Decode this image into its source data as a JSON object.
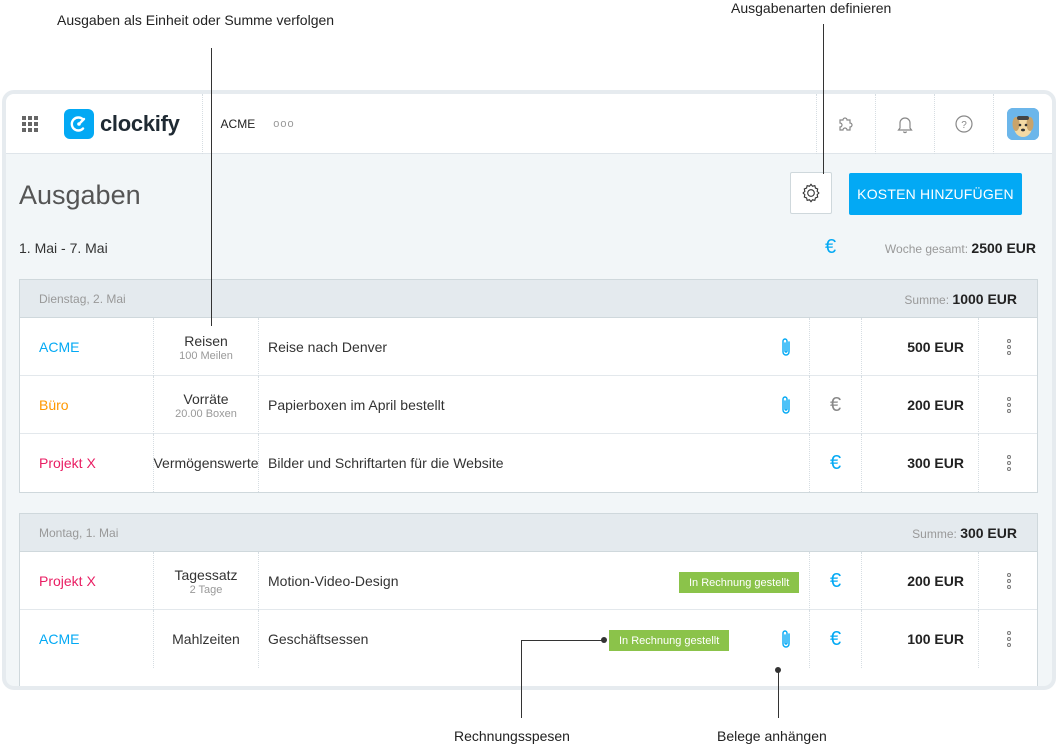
{
  "annotations": {
    "track_units": "Ausgaben als Einheit oder Summe verfolgen",
    "define_types": "Ausgabenarten definieren",
    "invoice_expenses": "Rechnungsspesen",
    "attach_receipts": "Belege anhängen"
  },
  "topbar": {
    "app_name": "clockify",
    "workspace": "ACME",
    "more": "ooo",
    "icons": [
      "apps-grid-icon",
      "puzzle-icon",
      "bell-icon",
      "help-icon",
      "avatar"
    ]
  },
  "page": {
    "title": "Ausgaben",
    "add_button": "KOSTEN HINZUFÜGEN",
    "range": "1. Mai - 7. Mai",
    "currency_symbol": "€",
    "week_total_label": "Woche gesamt: ",
    "week_total_value": "2500 EUR"
  },
  "colors": {
    "brand": "#03a9f4",
    "acme": "#03a9f4",
    "buero": "#ff9800",
    "projekt_x": "#e91e63",
    "invoiced_badge": "#8bc34a"
  },
  "groups": [
    {
      "date": "Dienstag, 2. Mai",
      "sum_label": "Summe: ",
      "sum_value": "1000 EUR",
      "rows": [
        {
          "project": "ACME",
          "category": "Reisen",
          "category_sub": "100 Meilen",
          "description": "Reise nach Denver",
          "amount": "500 EUR",
          "receipt": true,
          "billable": "",
          "invoiced": ""
        },
        {
          "project": "Büro",
          "category": "Vorräte",
          "category_sub": "20.00 Boxen",
          "description": "Papierboxen im April bestellt",
          "amount": "200 EUR",
          "receipt": true,
          "billable": "€",
          "invoiced": ""
        },
        {
          "project": "Projekt X",
          "category": "Vermögenswerte",
          "category_sub": "",
          "description": "Bilder und Schriftarten für die Website",
          "amount": "300 EUR",
          "receipt": false,
          "billable": "€",
          "invoiced": ""
        }
      ]
    },
    {
      "date": "Montag, 1. Mai",
      "sum_label": "Summe: ",
      "sum_value": "300 EUR",
      "rows": [
        {
          "project": "Projekt X",
          "category": "Tagessatz",
          "category_sub": "2 Tage",
          "description": "Motion-Video-Design",
          "amount": "200 EUR",
          "receipt": false,
          "billable": "€",
          "invoiced": "In Rechnung gestellt"
        },
        {
          "project": "ACME",
          "category": "Mahlzeiten",
          "category_sub": "",
          "description": "Geschäftsessen",
          "amount": "100 EUR",
          "receipt": true,
          "billable": "€",
          "invoiced": "In Rechnung gestellt"
        }
      ]
    }
  ]
}
